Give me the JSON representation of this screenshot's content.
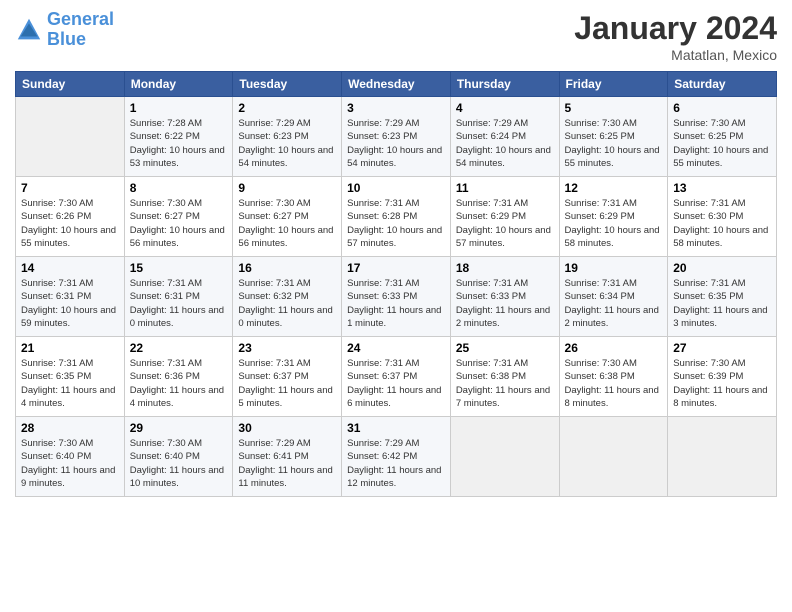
{
  "header": {
    "logo_line1": "General",
    "logo_line2": "Blue",
    "month_title": "January 2024",
    "location": "Matatlan, Mexico"
  },
  "days_of_week": [
    "Sunday",
    "Monday",
    "Tuesday",
    "Wednesday",
    "Thursday",
    "Friday",
    "Saturday"
  ],
  "weeks": [
    [
      {
        "num": "",
        "sunrise": "",
        "sunset": "",
        "daylight": ""
      },
      {
        "num": "1",
        "sunrise": "Sunrise: 7:28 AM",
        "sunset": "Sunset: 6:22 PM",
        "daylight": "Daylight: 10 hours and 53 minutes."
      },
      {
        "num": "2",
        "sunrise": "Sunrise: 7:29 AM",
        "sunset": "Sunset: 6:23 PM",
        "daylight": "Daylight: 10 hours and 54 minutes."
      },
      {
        "num": "3",
        "sunrise": "Sunrise: 7:29 AM",
        "sunset": "Sunset: 6:23 PM",
        "daylight": "Daylight: 10 hours and 54 minutes."
      },
      {
        "num": "4",
        "sunrise": "Sunrise: 7:29 AM",
        "sunset": "Sunset: 6:24 PM",
        "daylight": "Daylight: 10 hours and 54 minutes."
      },
      {
        "num": "5",
        "sunrise": "Sunrise: 7:30 AM",
        "sunset": "Sunset: 6:25 PM",
        "daylight": "Daylight: 10 hours and 55 minutes."
      },
      {
        "num": "6",
        "sunrise": "Sunrise: 7:30 AM",
        "sunset": "Sunset: 6:25 PM",
        "daylight": "Daylight: 10 hours and 55 minutes."
      }
    ],
    [
      {
        "num": "7",
        "sunrise": "Sunrise: 7:30 AM",
        "sunset": "Sunset: 6:26 PM",
        "daylight": "Daylight: 10 hours and 55 minutes."
      },
      {
        "num": "8",
        "sunrise": "Sunrise: 7:30 AM",
        "sunset": "Sunset: 6:27 PM",
        "daylight": "Daylight: 10 hours and 56 minutes."
      },
      {
        "num": "9",
        "sunrise": "Sunrise: 7:30 AM",
        "sunset": "Sunset: 6:27 PM",
        "daylight": "Daylight: 10 hours and 56 minutes."
      },
      {
        "num": "10",
        "sunrise": "Sunrise: 7:31 AM",
        "sunset": "Sunset: 6:28 PM",
        "daylight": "Daylight: 10 hours and 57 minutes."
      },
      {
        "num": "11",
        "sunrise": "Sunrise: 7:31 AM",
        "sunset": "Sunset: 6:29 PM",
        "daylight": "Daylight: 10 hours and 57 minutes."
      },
      {
        "num": "12",
        "sunrise": "Sunrise: 7:31 AM",
        "sunset": "Sunset: 6:29 PM",
        "daylight": "Daylight: 10 hours and 58 minutes."
      },
      {
        "num": "13",
        "sunrise": "Sunrise: 7:31 AM",
        "sunset": "Sunset: 6:30 PM",
        "daylight": "Daylight: 10 hours and 58 minutes."
      }
    ],
    [
      {
        "num": "14",
        "sunrise": "Sunrise: 7:31 AM",
        "sunset": "Sunset: 6:31 PM",
        "daylight": "Daylight: 10 hours and 59 minutes."
      },
      {
        "num": "15",
        "sunrise": "Sunrise: 7:31 AM",
        "sunset": "Sunset: 6:31 PM",
        "daylight": "Daylight: 11 hours and 0 minutes."
      },
      {
        "num": "16",
        "sunrise": "Sunrise: 7:31 AM",
        "sunset": "Sunset: 6:32 PM",
        "daylight": "Daylight: 11 hours and 0 minutes."
      },
      {
        "num": "17",
        "sunrise": "Sunrise: 7:31 AM",
        "sunset": "Sunset: 6:33 PM",
        "daylight": "Daylight: 11 hours and 1 minute."
      },
      {
        "num": "18",
        "sunrise": "Sunrise: 7:31 AM",
        "sunset": "Sunset: 6:33 PM",
        "daylight": "Daylight: 11 hours and 2 minutes."
      },
      {
        "num": "19",
        "sunrise": "Sunrise: 7:31 AM",
        "sunset": "Sunset: 6:34 PM",
        "daylight": "Daylight: 11 hours and 2 minutes."
      },
      {
        "num": "20",
        "sunrise": "Sunrise: 7:31 AM",
        "sunset": "Sunset: 6:35 PM",
        "daylight": "Daylight: 11 hours and 3 minutes."
      }
    ],
    [
      {
        "num": "21",
        "sunrise": "Sunrise: 7:31 AM",
        "sunset": "Sunset: 6:35 PM",
        "daylight": "Daylight: 11 hours and 4 minutes."
      },
      {
        "num": "22",
        "sunrise": "Sunrise: 7:31 AM",
        "sunset": "Sunset: 6:36 PM",
        "daylight": "Daylight: 11 hours and 4 minutes."
      },
      {
        "num": "23",
        "sunrise": "Sunrise: 7:31 AM",
        "sunset": "Sunset: 6:37 PM",
        "daylight": "Daylight: 11 hours and 5 minutes."
      },
      {
        "num": "24",
        "sunrise": "Sunrise: 7:31 AM",
        "sunset": "Sunset: 6:37 PM",
        "daylight": "Daylight: 11 hours and 6 minutes."
      },
      {
        "num": "25",
        "sunrise": "Sunrise: 7:31 AM",
        "sunset": "Sunset: 6:38 PM",
        "daylight": "Daylight: 11 hours and 7 minutes."
      },
      {
        "num": "26",
        "sunrise": "Sunrise: 7:30 AM",
        "sunset": "Sunset: 6:38 PM",
        "daylight": "Daylight: 11 hours and 8 minutes."
      },
      {
        "num": "27",
        "sunrise": "Sunrise: 7:30 AM",
        "sunset": "Sunset: 6:39 PM",
        "daylight": "Daylight: 11 hours and 8 minutes."
      }
    ],
    [
      {
        "num": "28",
        "sunrise": "Sunrise: 7:30 AM",
        "sunset": "Sunset: 6:40 PM",
        "daylight": "Daylight: 11 hours and 9 minutes."
      },
      {
        "num": "29",
        "sunrise": "Sunrise: 7:30 AM",
        "sunset": "Sunset: 6:40 PM",
        "daylight": "Daylight: 11 hours and 10 minutes."
      },
      {
        "num": "30",
        "sunrise": "Sunrise: 7:29 AM",
        "sunset": "Sunset: 6:41 PM",
        "daylight": "Daylight: 11 hours and 11 minutes."
      },
      {
        "num": "31",
        "sunrise": "Sunrise: 7:29 AM",
        "sunset": "Sunset: 6:42 PM",
        "daylight": "Daylight: 11 hours and 12 minutes."
      },
      {
        "num": "",
        "sunrise": "",
        "sunset": "",
        "daylight": ""
      },
      {
        "num": "",
        "sunrise": "",
        "sunset": "",
        "daylight": ""
      },
      {
        "num": "",
        "sunrise": "",
        "sunset": "",
        "daylight": ""
      }
    ]
  ]
}
